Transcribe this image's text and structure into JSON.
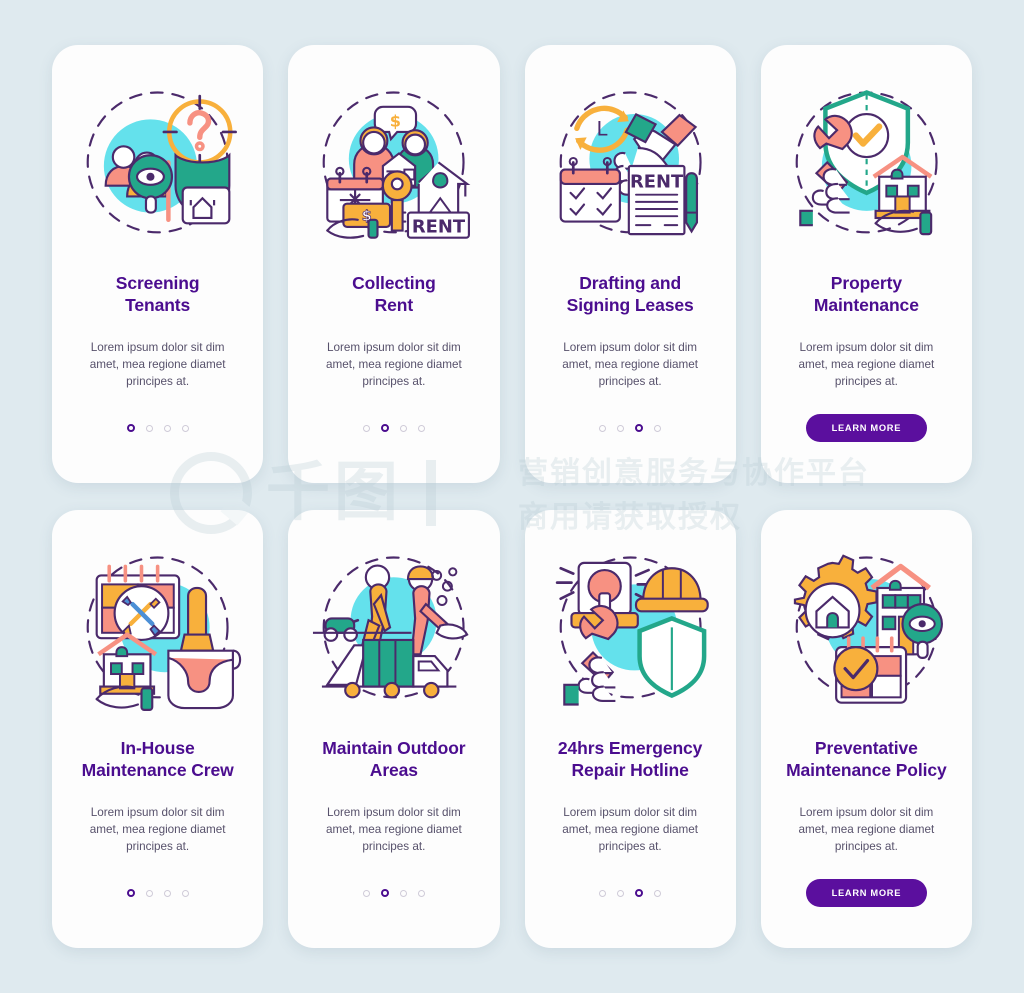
{
  "page": {
    "background_color": "#dfeaef",
    "card_background": "#fdfdfd",
    "title_color": "#4b0d8f",
    "body_color": "#57516b",
    "cta_color": "#5b0f9e",
    "accent_cyan": "#64e1ec",
    "accent_orange": "#f8b03c",
    "accent_coral": "#f79182",
    "accent_teal": "#23a78a",
    "accent_outline": "#4b2a6b"
  },
  "shared": {
    "body_lines": [
      "Lorem ipsum dolor sit dim",
      "amet, mea regione diamet",
      "principes at."
    ],
    "cta_label": "LEARN MORE",
    "dot_count": 4
  },
  "watermark": {
    "logo_text": "千图",
    "line1": "营销创意服务与协作平台",
    "line2": "商用请获取授权"
  },
  "screens": [
    {
      "id": "screening-tenants",
      "icon": "magnifier-people-shield-icon",
      "title_lines": [
        "Screening",
        "Tenants"
      ],
      "body_lines": [
        "Lorem ipsum dolor sit dim",
        "amet, mea regione diamet",
        "principes at."
      ],
      "footer_type": "dots",
      "active_dot": 1,
      "dot_count": 4,
      "cta_label": ""
    },
    {
      "id": "collecting-rent",
      "icon": "rent-key-calendar-icon",
      "title_lines": [
        "Collecting",
        "Rent"
      ],
      "body_lines": [
        "Lorem ipsum dolor sit dim",
        "amet, mea regione diamet",
        "principes at."
      ],
      "footer_type": "dots",
      "active_dot": 2,
      "dot_count": 4,
      "cta_label": ""
    },
    {
      "id": "drafting-signing-leases",
      "icon": "handshake-rent-document-icon",
      "title_lines": [
        "Drafting and",
        "Signing Leases"
      ],
      "body_lines": [
        "Lorem ipsum dolor sit dim",
        "amet, mea regione diamet",
        "principes at."
      ],
      "footer_type": "dots",
      "active_dot": 3,
      "dot_count": 4,
      "cta_label": ""
    },
    {
      "id": "property-maintenance",
      "icon": "shield-wrench-house-icon",
      "title_lines": [
        "Property",
        "Maintenance"
      ],
      "body_lines": [
        "Lorem ipsum dolor sit dim",
        "amet, mea regione diamet",
        "principes at."
      ],
      "footer_type": "button",
      "active_dot": 0,
      "dot_count": 4,
      "cta_label": "LEARN MORE"
    },
    {
      "id": "in-house-maintenance-crew",
      "icon": "calendar-tools-paint-house-icon",
      "title_lines": [
        "In-House",
        "Maintenance Crew"
      ],
      "body_lines": [
        "Lorem ipsum dolor sit dim",
        "amet, mea regione diamet",
        "principes at."
      ],
      "footer_type": "dots",
      "active_dot": 1,
      "dot_count": 4,
      "cta_label": ""
    },
    {
      "id": "maintain-outdoor-areas",
      "icon": "landscaping-garbage-truck-icon",
      "title_lines": [
        "Maintain Outdoor",
        "Areas"
      ],
      "body_lines": [
        "Lorem ipsum dolor sit dim",
        "amet, mea regione diamet",
        "principes at."
      ],
      "footer_type": "dots",
      "active_dot": 2,
      "dot_count": 4,
      "cta_label": ""
    },
    {
      "id": "24hrs-emergency-repair-hotline",
      "icon": "siren-helmet-wrench-shield-icon",
      "title_lines": [
        "24hrs Emergency",
        "Repair Hotline"
      ],
      "body_lines": [
        "Lorem ipsum dolor sit dim",
        "amet, mea regione diamet",
        "principes at."
      ],
      "footer_type": "dots",
      "active_dot": 3,
      "dot_count": 4,
      "cta_label": ""
    },
    {
      "id": "preventative-maintenance-policy",
      "icon": "gear-house-calendar-check-icon",
      "title_lines": [
        "Preventative",
        "Maintenance Policy"
      ],
      "body_lines": [
        "Lorem ipsum dolor sit dim",
        "amet, mea regione diamet",
        "principes at."
      ],
      "footer_type": "button",
      "active_dot": 0,
      "dot_count": 4,
      "cta_label": "LEARN MORE"
    }
  ]
}
